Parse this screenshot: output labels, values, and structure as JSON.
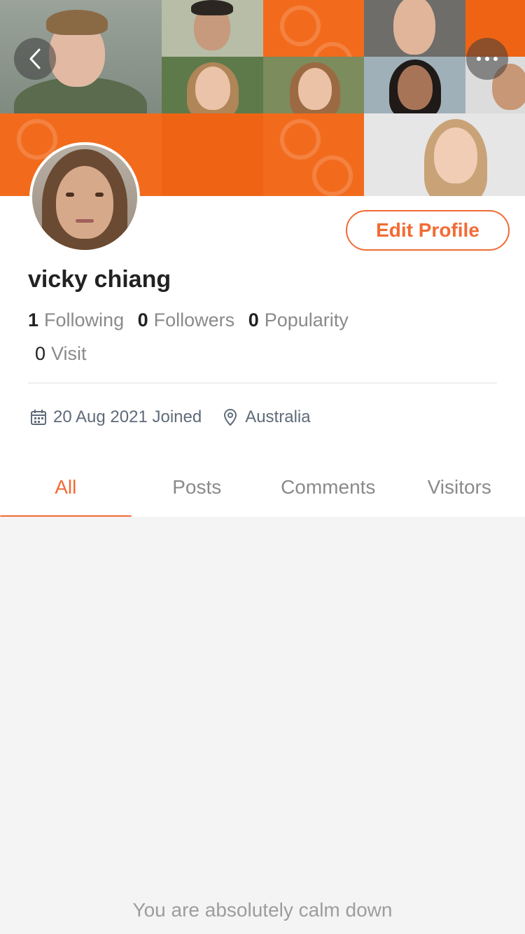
{
  "colors": {
    "accent": "#f26b35",
    "cover_orange": "#f26b1d",
    "text_dark": "#222222",
    "text_muted": "#8a8a8a"
  },
  "header": {
    "back_icon": "chevron-left-icon",
    "more_icon": "more-horizontal-icon"
  },
  "profile": {
    "name": "vicky chiang",
    "edit_label": "Edit Profile",
    "stats": {
      "following_count": "1",
      "following_label": "Following",
      "followers_count": "0",
      "followers_label": "Followers",
      "popularity_count": "0",
      "popularity_label": "Popularity",
      "visit_count": "0",
      "visit_label": "Visit"
    },
    "joined": "20 Aug 2021 Joined",
    "location": "Australia"
  },
  "tabs": [
    {
      "label": "All",
      "active": true
    },
    {
      "label": "Posts",
      "active": false
    },
    {
      "label": "Comments",
      "active": false
    },
    {
      "label": "Visitors",
      "active": false
    }
  ],
  "empty_state": "You are absolutely calm down"
}
